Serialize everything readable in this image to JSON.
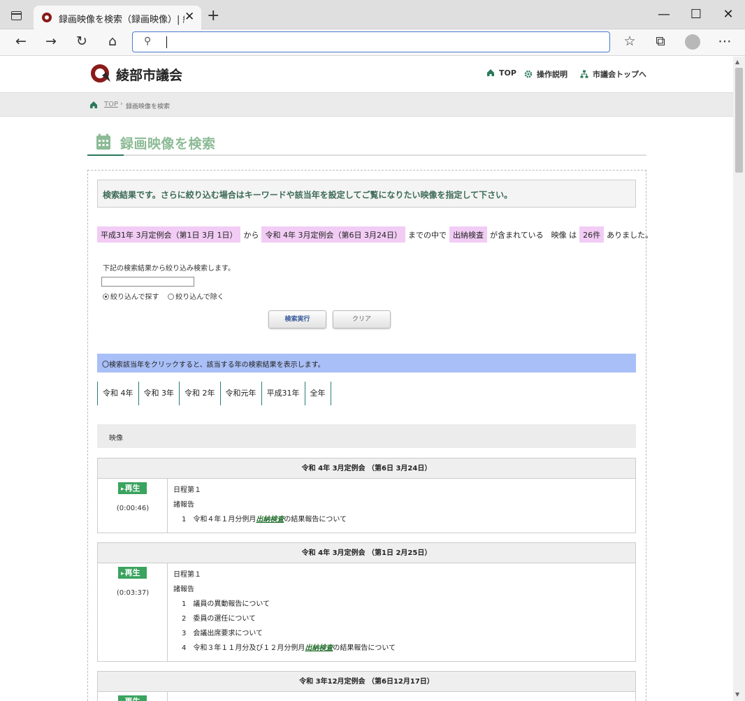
{
  "browser": {
    "tab_title": "録画映像を検索（録画映像）| 綾",
    "address": ""
  },
  "site": {
    "logo_text": "綾部市議会",
    "nav": [
      "TOP",
      "操作説明",
      "市議会トップへ"
    ],
    "breadcrumb": {
      "home": "TOP",
      "current": "録画映像を検索"
    },
    "page_title": "録画映像を検索"
  },
  "search": {
    "notice": "検索結果です。さらに絞り込む場合はキーワードや該当年を設定してご覧になりたい映像を指定して下さい。",
    "from": "平成31年 3月定例会（第1日 3月 1日）",
    "from_suffix": "から",
    "to": "令和 4年 3月定例会（第6日 3月24日）",
    "to_suffix": "までの中で",
    "keyword": "出納検査",
    "keyword_suffix": "が含まれている　映像 は",
    "count": "26件",
    "count_suffix": "ありました。",
    "refine_label": "下記の検索結果から絞り込み検索します。",
    "refine_value": "",
    "radio_include": "絞り込んで探す",
    "radio_exclude": "絞り込んで除く",
    "btn_search": "検索実行",
    "btn_clear": "クリア"
  },
  "years": {
    "hint": "〇検索該当年をクリックすると、該当する年の検索結果を表示します。",
    "tabs": [
      "令和 4年",
      "令和 3年",
      "令和 2年",
      "令和元年",
      "平成31年",
      "全年"
    ]
  },
  "results": {
    "header": "映像",
    "play_label": "再生",
    "sessions": [
      {
        "title": "令和 4年 3月定例会 （第6日 3月24日）",
        "duration": "(0:00:46)",
        "lines": [
          {
            "t": "日程第１"
          },
          {
            "t": "諸報告"
          },
          {
            "t": "1　令和４年１月分例月",
            "kw": "出納検査",
            "after": "の結果報告について"
          }
        ]
      },
      {
        "title": "令和 4年 3月定例会 （第1日 2月25日）",
        "duration": "(0:03:37)",
        "lines": [
          {
            "t": "日程第１"
          },
          {
            "t": "諸報告"
          },
          {
            "t": "1　議員の異動報告について"
          },
          {
            "t": "2　委員の選任について"
          },
          {
            "t": "3　会議出席要求について"
          },
          {
            "t": "4　令和３年１１月分及び１２月分例月",
            "kw": "出納検査",
            "after": "の結果報告について"
          }
        ]
      },
      {
        "title": "令和 3年12月定例会 （第6日12月17日）",
        "duration": "",
        "lines": []
      }
    ]
  },
  "colors": {
    "accent_green": "#2a7a5a",
    "highlight_pink": "#f2ccf5",
    "year_bar_blue": "#a9bff7",
    "play_green": "#3aa35e"
  }
}
